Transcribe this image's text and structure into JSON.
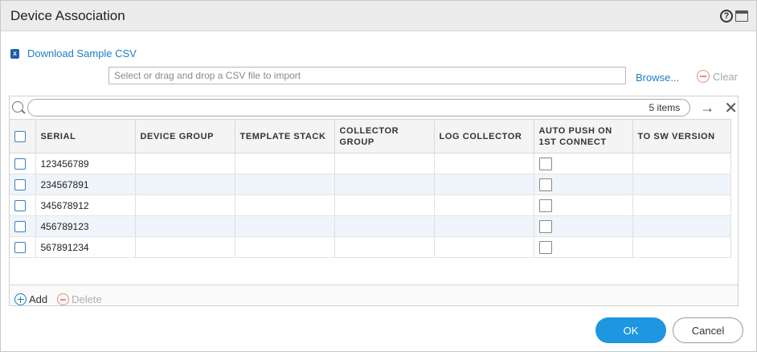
{
  "dialog": {
    "title": "Device Association",
    "help_icon_glyph": "?"
  },
  "import": {
    "csv_icon": "x",
    "download_label": "Download Sample CSV",
    "file_placeholder": "Select or drag and drop a CSV file to import",
    "browse_label": "Browse...",
    "clear_label": "Clear"
  },
  "grid": {
    "search_count": "5 items",
    "columns": [
      "SERIAL",
      "DEVICE GROUP",
      "TEMPLATE STACK",
      "COLLECTOR GROUP",
      "LOG COLLECTOR",
      "AUTO PUSH ON 1ST CONNECT",
      "TO SW VERSION"
    ],
    "rows": [
      {
        "serial": "123456789"
      },
      {
        "serial": "234567891"
      },
      {
        "serial": "345678912"
      },
      {
        "serial": "456789123"
      },
      {
        "serial": "567891234"
      }
    ],
    "add_label": "Add",
    "delete_label": "Delete"
  },
  "buttons": {
    "ok": "OK",
    "cancel": "Cancel"
  },
  "colors": {
    "accent": "#1e96e0",
    "link": "#1c7ec8",
    "row_alt": "#eff5fb"
  }
}
